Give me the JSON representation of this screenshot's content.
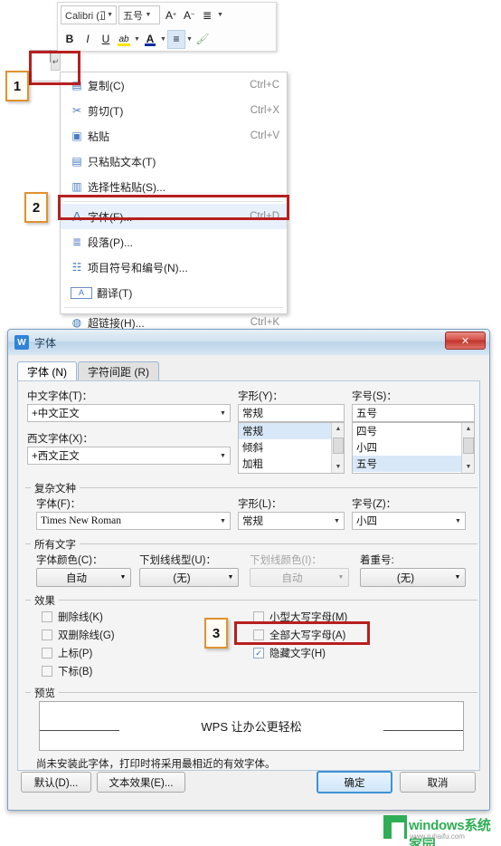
{
  "mini_toolbar": {
    "font_name": "Calibri (正",
    "font_size": "五号",
    "grow_font": "A",
    "shrink_font": "A",
    "line_spacing_icon": "line-spacing-icon",
    "bold": "B",
    "italic": "I",
    "underline": "U",
    "highlight": "ab",
    "font_color": "A",
    "align": "≡",
    "format_painter": "format-painter-icon"
  },
  "document": {
    "paragraph_mark": "↵"
  },
  "context_menu": {
    "items": [
      {
        "icon": "copy-icon",
        "glyph": "▤",
        "label": "复制(C)",
        "accel": "Ctrl+C",
        "selected": false
      },
      {
        "icon": "cut-icon",
        "glyph": "✂",
        "label": "剪切(T)",
        "accel": "Ctrl+X",
        "selected": false
      },
      {
        "icon": "paste-icon",
        "glyph": "▣",
        "label": "粘贴",
        "accel": "Ctrl+V",
        "selected": false
      },
      {
        "icon": "paste-text-icon",
        "glyph": "▤",
        "label": "只粘贴文本(T)",
        "accel": "",
        "selected": false
      },
      {
        "icon": "paste-special-icon",
        "glyph": "▥",
        "label": "选择性粘贴(S)...",
        "accel": "",
        "selected": false
      },
      {
        "icon": "font-icon",
        "glyph": "A",
        "label": "字体(F)...",
        "accel": "Ctrl+D",
        "selected": true
      },
      {
        "icon": "paragraph-icon",
        "glyph": "≣",
        "label": "段落(P)...",
        "accel": "",
        "selected": false
      },
      {
        "icon": "bullets-icon",
        "glyph": "☰",
        "label": "项目符号和编号(N)...",
        "accel": "",
        "selected": false
      },
      {
        "icon": "translate-icon",
        "glyph": "A",
        "label": "翻译(T)",
        "accel": "",
        "selected": false
      },
      {
        "icon": "hyperlink-icon",
        "glyph": "🌐",
        "label": "超链接(H)...",
        "accel": "Ctrl+K",
        "selected": false
      }
    ]
  },
  "callouts": [
    {
      "number": "1"
    },
    {
      "number": "2"
    },
    {
      "number": "3"
    }
  ],
  "dialog": {
    "title": "字体",
    "icon": "wps-logo-icon",
    "close_label": "✕",
    "tabs": [
      {
        "label": "字体 (N)",
        "active": true
      },
      {
        "label": "字符间距 (R)",
        "active": false
      }
    ],
    "chinese_font": {
      "label": "中文字体(T)：",
      "value": "+中文正文"
    },
    "western_font": {
      "label": "西文字体(X)：",
      "value": "+西文正文"
    },
    "font_style": {
      "label": "字形(Y)：",
      "value": "常规",
      "options": [
        "常规",
        "倾斜",
        "加粗"
      ],
      "selected_index": 0
    },
    "font_size": {
      "label": "字号(S)：",
      "value": "五号",
      "options": [
        "四号",
        "小四",
        "五号"
      ],
      "selected_index": 2
    },
    "complex_script": {
      "caption": "复杂文种",
      "font": {
        "label": "字体(F)：",
        "value": "Times New Roman"
      },
      "style": {
        "label": "字形(L)：",
        "value": "常规"
      },
      "size": {
        "label": "字号(Z)：",
        "value": "小四"
      }
    },
    "all_text": {
      "caption": "所有文字",
      "font_color": {
        "label": "字体颜色(C)：",
        "value": "自动",
        "disabled": false
      },
      "underline_style": {
        "label": "下划线线型(U)：",
        "value": "(无)",
        "disabled": false
      },
      "underline_color": {
        "label": "下划线颜色(I)：",
        "value": "自动",
        "disabled": true
      },
      "emphasis_mark": {
        "label": "着重号:",
        "value": "(无)",
        "disabled": false
      }
    },
    "effects": {
      "caption": "效果",
      "left_column": [
        {
          "label": "删除线(K)",
          "checked": false
        },
        {
          "label": "双删除线(G)",
          "checked": false
        },
        {
          "label": "上标(P)",
          "checked": false
        },
        {
          "label": "下标(B)",
          "checked": false
        }
      ],
      "right_column": [
        {
          "label": "小型大写字母(M)",
          "checked": false
        },
        {
          "label": "全部大写字母(A)",
          "checked": false
        },
        {
          "label": "隐藏文字(H)",
          "checked": true
        }
      ]
    },
    "preview": {
      "caption": "预览",
      "text": "WPS 让办公更轻松",
      "note": "尚未安装此字体，打印时将采用最相近的有效字体。"
    },
    "buttons": {
      "default": "默认(D)...",
      "text_effects": "文本效果(E)...",
      "ok": "确定",
      "cancel": "取消"
    }
  },
  "watermark": {
    "brand_en": "windows",
    "brand_cn": "系统家园",
    "url": "www.ruhaifu.com"
  },
  "colors": {
    "callout_border": "#e0922f",
    "highlight_rect": "#b81f1f",
    "accent_blue": "#3d93d8",
    "watermark_green": "#2fae55"
  }
}
